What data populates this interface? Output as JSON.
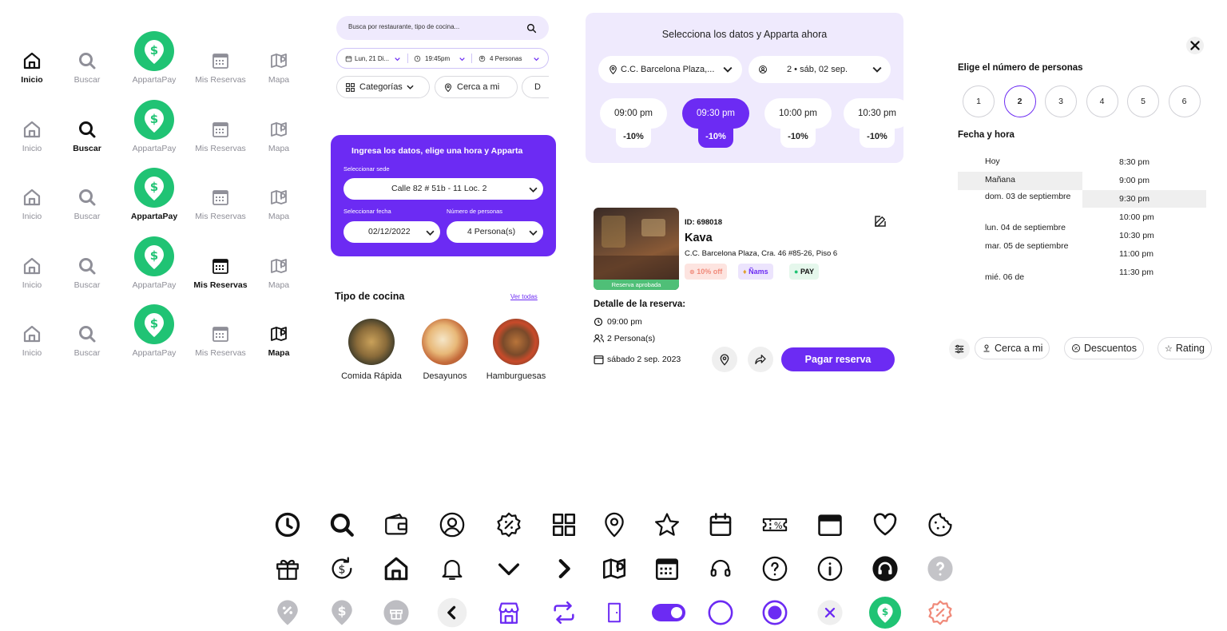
{
  "colors": {
    "brand_purple": "#6c2bf3",
    "light_purple": "#efeafd",
    "pay_green": "#20c374",
    "approved_green": "#4fbf77",
    "muted_text": "#8f8f98"
  },
  "nav": {
    "labels": {
      "inicio": "Inicio",
      "buscar": "Buscar",
      "apparta_pay": "AppartaPay",
      "mis_reservas": "Mis Reservas",
      "mapa": "Mapa"
    },
    "variants": [
      {
        "active": "inicio"
      },
      {
        "active": "buscar"
      },
      {
        "active": "apparta_pay"
      },
      {
        "active": "mis_reservas"
      },
      {
        "active": "mapa"
      }
    ]
  },
  "search": {
    "placeholder": "Busca por restaurante, tipo de cocina...",
    "date": "Lun, 21 Di...",
    "time": "19:45pm",
    "people": "4 Personas",
    "chips": {
      "categorias": "Categorías",
      "cerca": "Cerca a mi",
      "descuentos_partial": "D"
    }
  },
  "booking_form": {
    "title": "Ingresa los datos, elige una hora y Apparta",
    "sede_label": "Seleccionar sede",
    "sede_value": "Calle 82 # 51b - 11 Loc. 2",
    "fecha_label": "Seleccionar fecha",
    "fecha_value": "02/12/2022",
    "personas_label": "Número de personas",
    "personas_value": "4 Persona(s)"
  },
  "cuisine": {
    "title": "Tipo de cocina",
    "see_all": "Ver todas",
    "items": [
      "Comida Rápida",
      "Desayunos",
      "Hamburguesas"
    ]
  },
  "slot_panel": {
    "title": "Selecciona los datos y Apparta ahora",
    "location": "C.C. Barcelona Plaza,...",
    "people_date": "2 • sáb, 02 sep.",
    "slots": [
      {
        "time": "09:00 pm",
        "discount": "-10%",
        "active": false
      },
      {
        "time": "09:30 pm",
        "discount": "-10%",
        "active": true
      },
      {
        "time": "10:00 pm",
        "discount": "-10%",
        "active": false
      },
      {
        "time": "10:30 pm",
        "discount": "-10%",
        "active": false
      }
    ]
  },
  "reservation": {
    "status": "Reserva aprobada",
    "id": "ID: 698018",
    "name": "Kava",
    "address": "C.C. Barcelona Plaza, Cra. 46 #85-26, Piso 6",
    "badge_off": "10% off",
    "badge_nams": "Ñams",
    "badge_pay": "PAY",
    "detail_title": "Detalle de la reserva:",
    "time": "09:00 pm",
    "people": "2 Persona(s)",
    "date": "sábado 2 sep. 2023",
    "pay_button": "Pagar reserva"
  },
  "people_picker": {
    "title": "Elige el número de personas",
    "options": [
      "1",
      "2",
      "3",
      "4",
      "5",
      "6"
    ],
    "selected": "2",
    "datetime_title": "Fecha y hora",
    "days": [
      "Hoy",
      "Mañana",
      "dom. 03 de septiembre",
      "lun. 04 de septiembre",
      "mar. 05 de septiembre",
      "mié. 06 de"
    ],
    "selected_day": "Mañana",
    "hours": [
      "8:30 pm",
      "9:00 pm",
      "9:30 pm",
      "10:00 pm",
      "10:30 pm",
      "11:00 pm",
      "11:30 pm"
    ],
    "selected_hour": "9:30 pm"
  },
  "filters": {
    "cerca": "Cerca a mi",
    "descuentos": "Descuentos",
    "rating": "Rating"
  },
  "icon_grid": [
    [
      "clock-icon",
      "search-icon",
      "wallet-icon",
      "user-circle-icon",
      "discount-badge-icon",
      "grid-icon",
      "location-pin-icon",
      "star-icon",
      "calendar-icon",
      "coupon-icon",
      "calendar-filled-icon",
      "heart-icon",
      "cookie-icon"
    ],
    [
      "gift-icon",
      "refund-dollar-icon",
      "home-icon",
      "bell-icon",
      "chevron-down-icon",
      "chevron-right-icon",
      "map-icon",
      "calendar-grid-icon",
      "headset-icon",
      "help-circle-icon",
      "info-circle-icon",
      "headset-filled-icon",
      "help-filled-icon"
    ],
    [
      "discount-pin-icon",
      "dollar-pin-icon",
      "gift-circle-icon",
      "back-button-icon",
      "store-icon",
      "swap-icon",
      "door-icon",
      "toggle-on-icon",
      "radio-off-icon",
      "radio-on-icon",
      "close-circle-icon",
      "apparta-pay-icon",
      "discount-outline-icon"
    ]
  ]
}
